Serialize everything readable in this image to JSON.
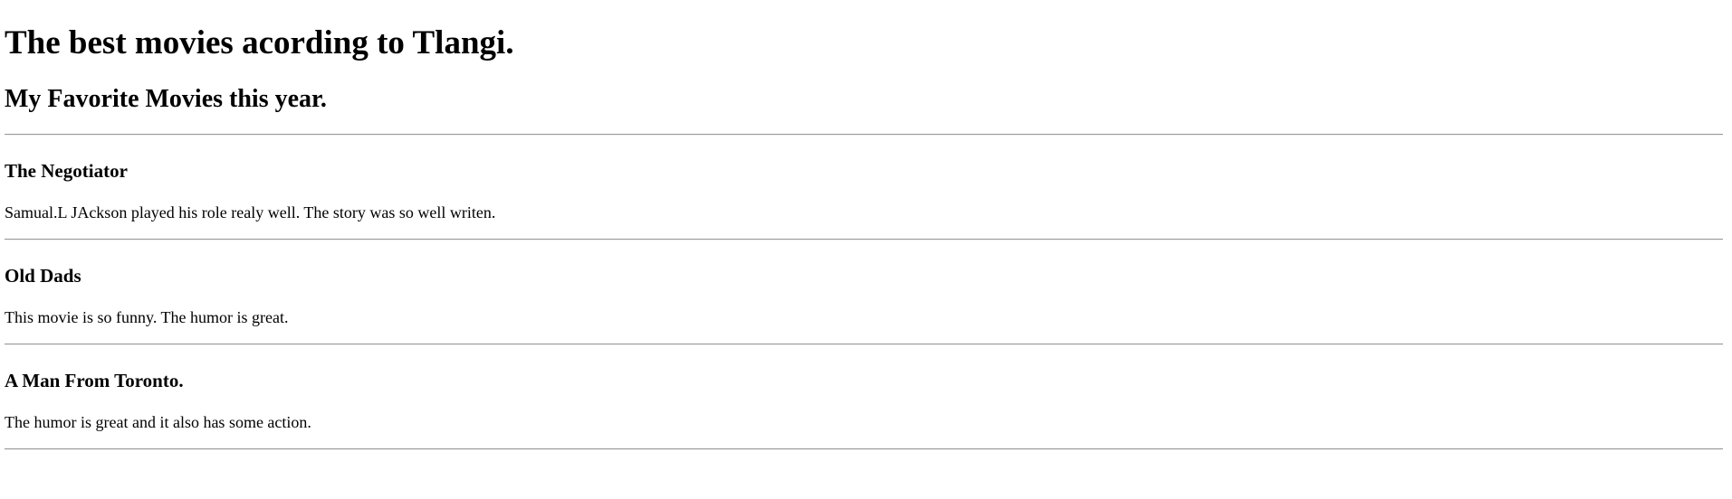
{
  "page": {
    "heading": "The best movies acording to Tlangi.",
    "subheading": "My Favorite Movies this year."
  },
  "movies": [
    {
      "title": "The Negotiator",
      "review": "Samual.L JAckson played his role realy well. The story was so well writen."
    },
    {
      "title": "Old Dads",
      "review": "This movie is so funny. The humor is great."
    },
    {
      "title": "A Man From Toronto.",
      "review": "The humor is great and it also has some action."
    }
  ]
}
